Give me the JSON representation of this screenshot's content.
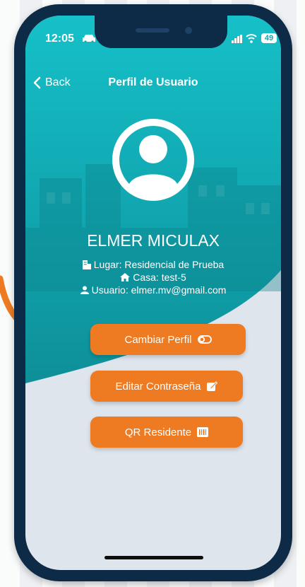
{
  "status_bar": {
    "time": "12:05",
    "battery": "49"
  },
  "nav": {
    "back_label": "Back",
    "title": "Perfil de Usuario"
  },
  "profile": {
    "name": "ELMER MICULAX",
    "lugar": "Lugar: Residencial de Prueba",
    "casa": "Casa: test-5",
    "usuario": "Usuario: elmer.mv@gmail.com"
  },
  "buttons": {
    "change_profile": "Cambiar Perfil",
    "edit_password": "Editar Contraseña",
    "qr": "QR Residente"
  },
  "colors": {
    "teal": "#12a8b2",
    "orange": "#ee7a22",
    "frame": "#0d2a47"
  },
  "icons": [
    "car-icon",
    "signal-icon",
    "wifi-icon",
    "battery-icon",
    "chevron-left-icon",
    "user-circle-icon",
    "building-icon",
    "house-icon",
    "person-icon",
    "toggle-icon",
    "edit-icon",
    "barcode-icon"
  ]
}
